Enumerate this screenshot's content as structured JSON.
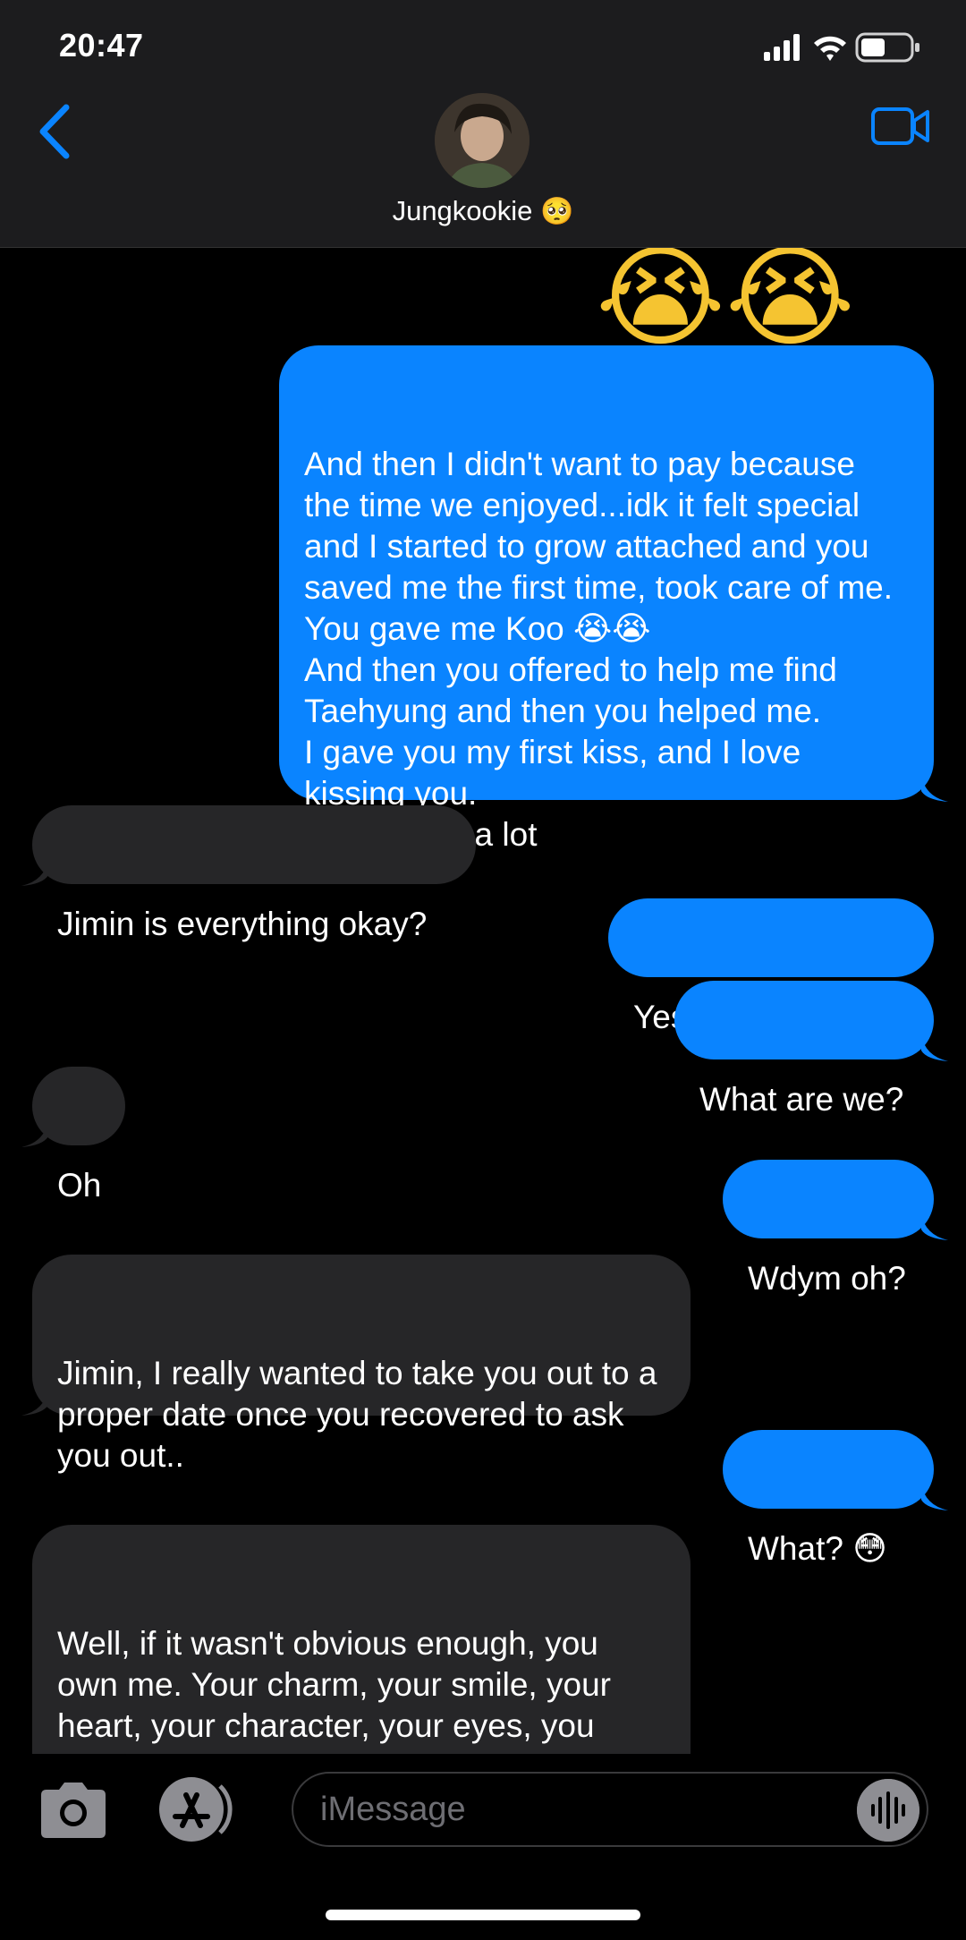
{
  "status": {
    "time": "20:47"
  },
  "header": {
    "contact_name": "Jungkookie",
    "contact_emoji": "🥺"
  },
  "messages": [
    {
      "from": "me",
      "text": "😭😭😭"
    },
    {
      "from": "me",
      "text": "And then I didn't want to pay because the time we enjoyed...idk it felt special and I started to grow attached and you saved me the first time, took care of me. You gave me Koo 😭😭\nAnd then you offered to help me find Taehyung and then you helped me.\nI gave you my first kiss, and I love kissing you.\nWe do kiss a lot"
    },
    {
      "from": "them",
      "text": "Jimin is everything okay?"
    },
    {
      "from": "me",
      "text": "Yes yes 😭 just..."
    },
    {
      "from": "me",
      "text": "What are we?"
    },
    {
      "from": "them",
      "text": "Oh"
    },
    {
      "from": "me",
      "text": "Wdym oh?"
    },
    {
      "from": "them",
      "text": "Jimin, I really wanted to take you out to a proper date once you recovered to ask you out.."
    },
    {
      "from": "me",
      "text": "What? 😳"
    },
    {
      "from": "them",
      "text": "Well, if it wasn't obvious enough, you own me. Your charm, your smile, your heart, your character, your eyes, you body, your soul...\nI'm all yours. There's no one I see"
    }
  ],
  "input": {
    "placeholder": "iMessage"
  },
  "colors": {
    "sent_bubble": "#0a84ff",
    "received_bubble": "#262628",
    "header_bg": "#1c1c1e",
    "accent": "#0a84ff"
  },
  "icons": [
    "back-chevron-icon",
    "video-call-icon",
    "camera-icon",
    "app-store-icon",
    "audio-waveform-icon",
    "signal-icon",
    "wifi-icon",
    "battery-icon"
  ]
}
